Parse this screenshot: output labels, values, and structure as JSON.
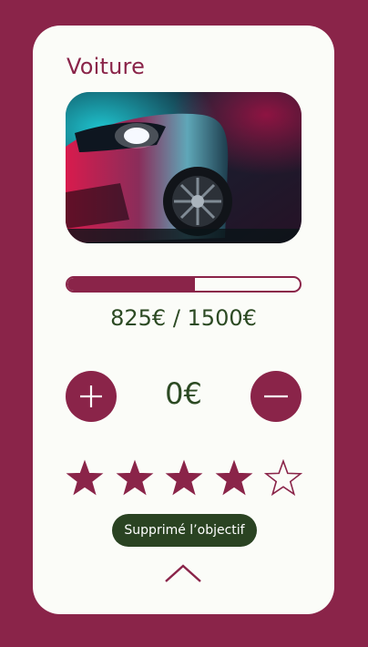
{
  "goal": {
    "title": "Voiture",
    "image_alt": "sports car photo",
    "progress_fraction": 0.55,
    "amount_text": "825€ / 1500€",
    "current_value": "0€",
    "rating": 4,
    "rating_max": 5,
    "delete_label": "Supprimé l’objectif"
  },
  "icons": {
    "plus": "plus-icon",
    "minus": "minus-icon",
    "star": "star-icon",
    "chevron": "chevron-up-icon"
  },
  "colors": {
    "primary": "#8a2449",
    "text_green": "#2c4a23",
    "pill_bg": "#2a4322",
    "card_bg": "#fbfcf8"
  }
}
